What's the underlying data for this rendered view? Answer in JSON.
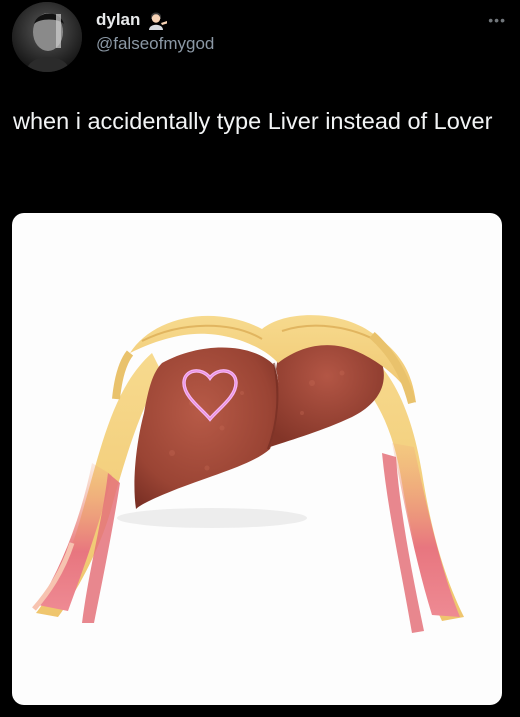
{
  "tweet": {
    "author": {
      "display_name": "dylan",
      "handle": "@falseofmygod",
      "name_emoji": "man-tipping-hand-emoji"
    },
    "more_icon": "more-dots-icon",
    "text": "when i accidentally type Liver instead of Lover"
  },
  "colors": {
    "background": "#000000",
    "text": "#e7e9ea",
    "secondary_text": "#8b98a5",
    "media_background": "#fdfdfd",
    "liver": "#a14a3b",
    "hair": "#f2cf7c",
    "hair_streaks": "#e9878a",
    "heart": "#f4a8f0"
  }
}
